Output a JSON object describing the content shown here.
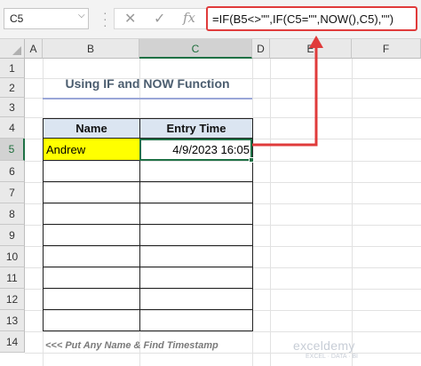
{
  "formula_bar": {
    "name_box": "C5",
    "name_box_dropdown": "⌵",
    "cancel_icon": "✕",
    "enter_icon": "✓",
    "fx_label": "fx",
    "formula": "=IF(B5<>\"\",IF(C5=\"\",NOW(),C5),\"\")"
  },
  "columns": [
    "A",
    "B",
    "C",
    "D",
    "E",
    "F"
  ],
  "rows": [
    "1",
    "2",
    "3",
    "4",
    "5",
    "6",
    "7",
    "8",
    "9",
    "10",
    "11",
    "12",
    "13",
    "14"
  ],
  "selected_cell": "C5",
  "title": "Using IF and NOW Function",
  "table": {
    "headers": {
      "name": "Name",
      "time": "Entry Time"
    },
    "rows": [
      {
        "name": "Andrew",
        "time": "4/9/2023 16:05"
      },
      {
        "name": "",
        "time": ""
      },
      {
        "name": "",
        "time": ""
      },
      {
        "name": "",
        "time": ""
      },
      {
        "name": "",
        "time": ""
      },
      {
        "name": "",
        "time": ""
      },
      {
        "name": "",
        "time": ""
      },
      {
        "name": "",
        "time": ""
      },
      {
        "name": "",
        "time": ""
      }
    ]
  },
  "note": "<<< Put Any Name & Find Timestamp",
  "watermark": {
    "brand": "exceldemy",
    "tagline": "EXCEL · DATA · BI"
  },
  "colors": {
    "accent_red": "#e03b3b",
    "excel_green": "#1e7145",
    "header_fill": "#dbe5f1",
    "highlight_yellow": "#ffff00"
  }
}
